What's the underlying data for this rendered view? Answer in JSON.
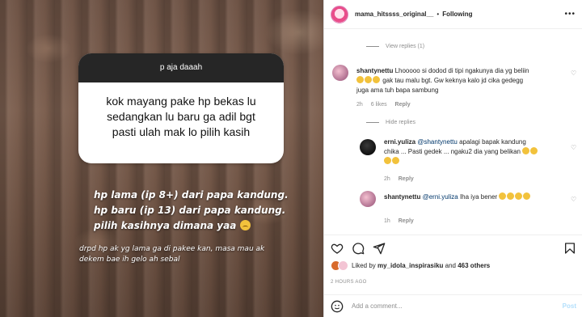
{
  "story": {
    "question_header": "p aja daaah",
    "question_lines": [
      "kok mayang pake hp bekas lu",
      "sedangkan lu baru ga adil bgt",
      "pasti ulah mak lo pilih kasih"
    ],
    "answer_lines": [
      "hp lama (ip 8+) dari papa kandung.",
      "hp baru (ip 13) dari papa kandung.",
      "pilih kasihnya dimana yaa"
    ],
    "footer_lines": [
      "drpd hp ak yg lama ga di pakee kan, masa mau ak",
      "dekem bae ih gelo ah sebal"
    ]
  },
  "header": {
    "username": "mama_hitssss_original__",
    "separator": "•",
    "follow_label": "Following",
    "more_icon": "more-horizontal-icon"
  },
  "comments": {
    "view_replies": "View replies (1)",
    "hide_replies": "Hide replies",
    "items": [
      {
        "username": "shantynettu",
        "text_a": "Lhooooo si dodod di tipi ngakunya dia yg beliin",
        "text_b": "gak tau malu bgt. Gw keknya kalo jd cika gedegg",
        "text_c": "juga ama tuh bapa sambung",
        "time": "2h",
        "likes": "6 likes",
        "reply": "Reply"
      },
      {
        "username": "erni.yuliza",
        "mention": "@shantynettu",
        "text_a": "apalagi bapak kandung",
        "text_b": "chika ... Pasti gedek ... ngaku2 dia yang belikan",
        "time": "2h",
        "reply": "Reply"
      },
      {
        "username": "shantynettu",
        "mention": "@erni.yuliza",
        "text_a": "Iha iya bener",
        "time": "1h",
        "reply": "Reply"
      }
    ]
  },
  "actions": {
    "like_icon": "heart-icon",
    "comment_icon": "comment-icon",
    "share_icon": "send-icon",
    "save_icon": "bookmark-icon"
  },
  "likes": {
    "prefix": "Liked by",
    "user": "my_idola_inspirasiku",
    "joiner": "and",
    "others": "463 others"
  },
  "time_ago": "2 HOURS AGO",
  "add_comment": {
    "placeholder": "Add a comment...",
    "post_label": "Post"
  }
}
